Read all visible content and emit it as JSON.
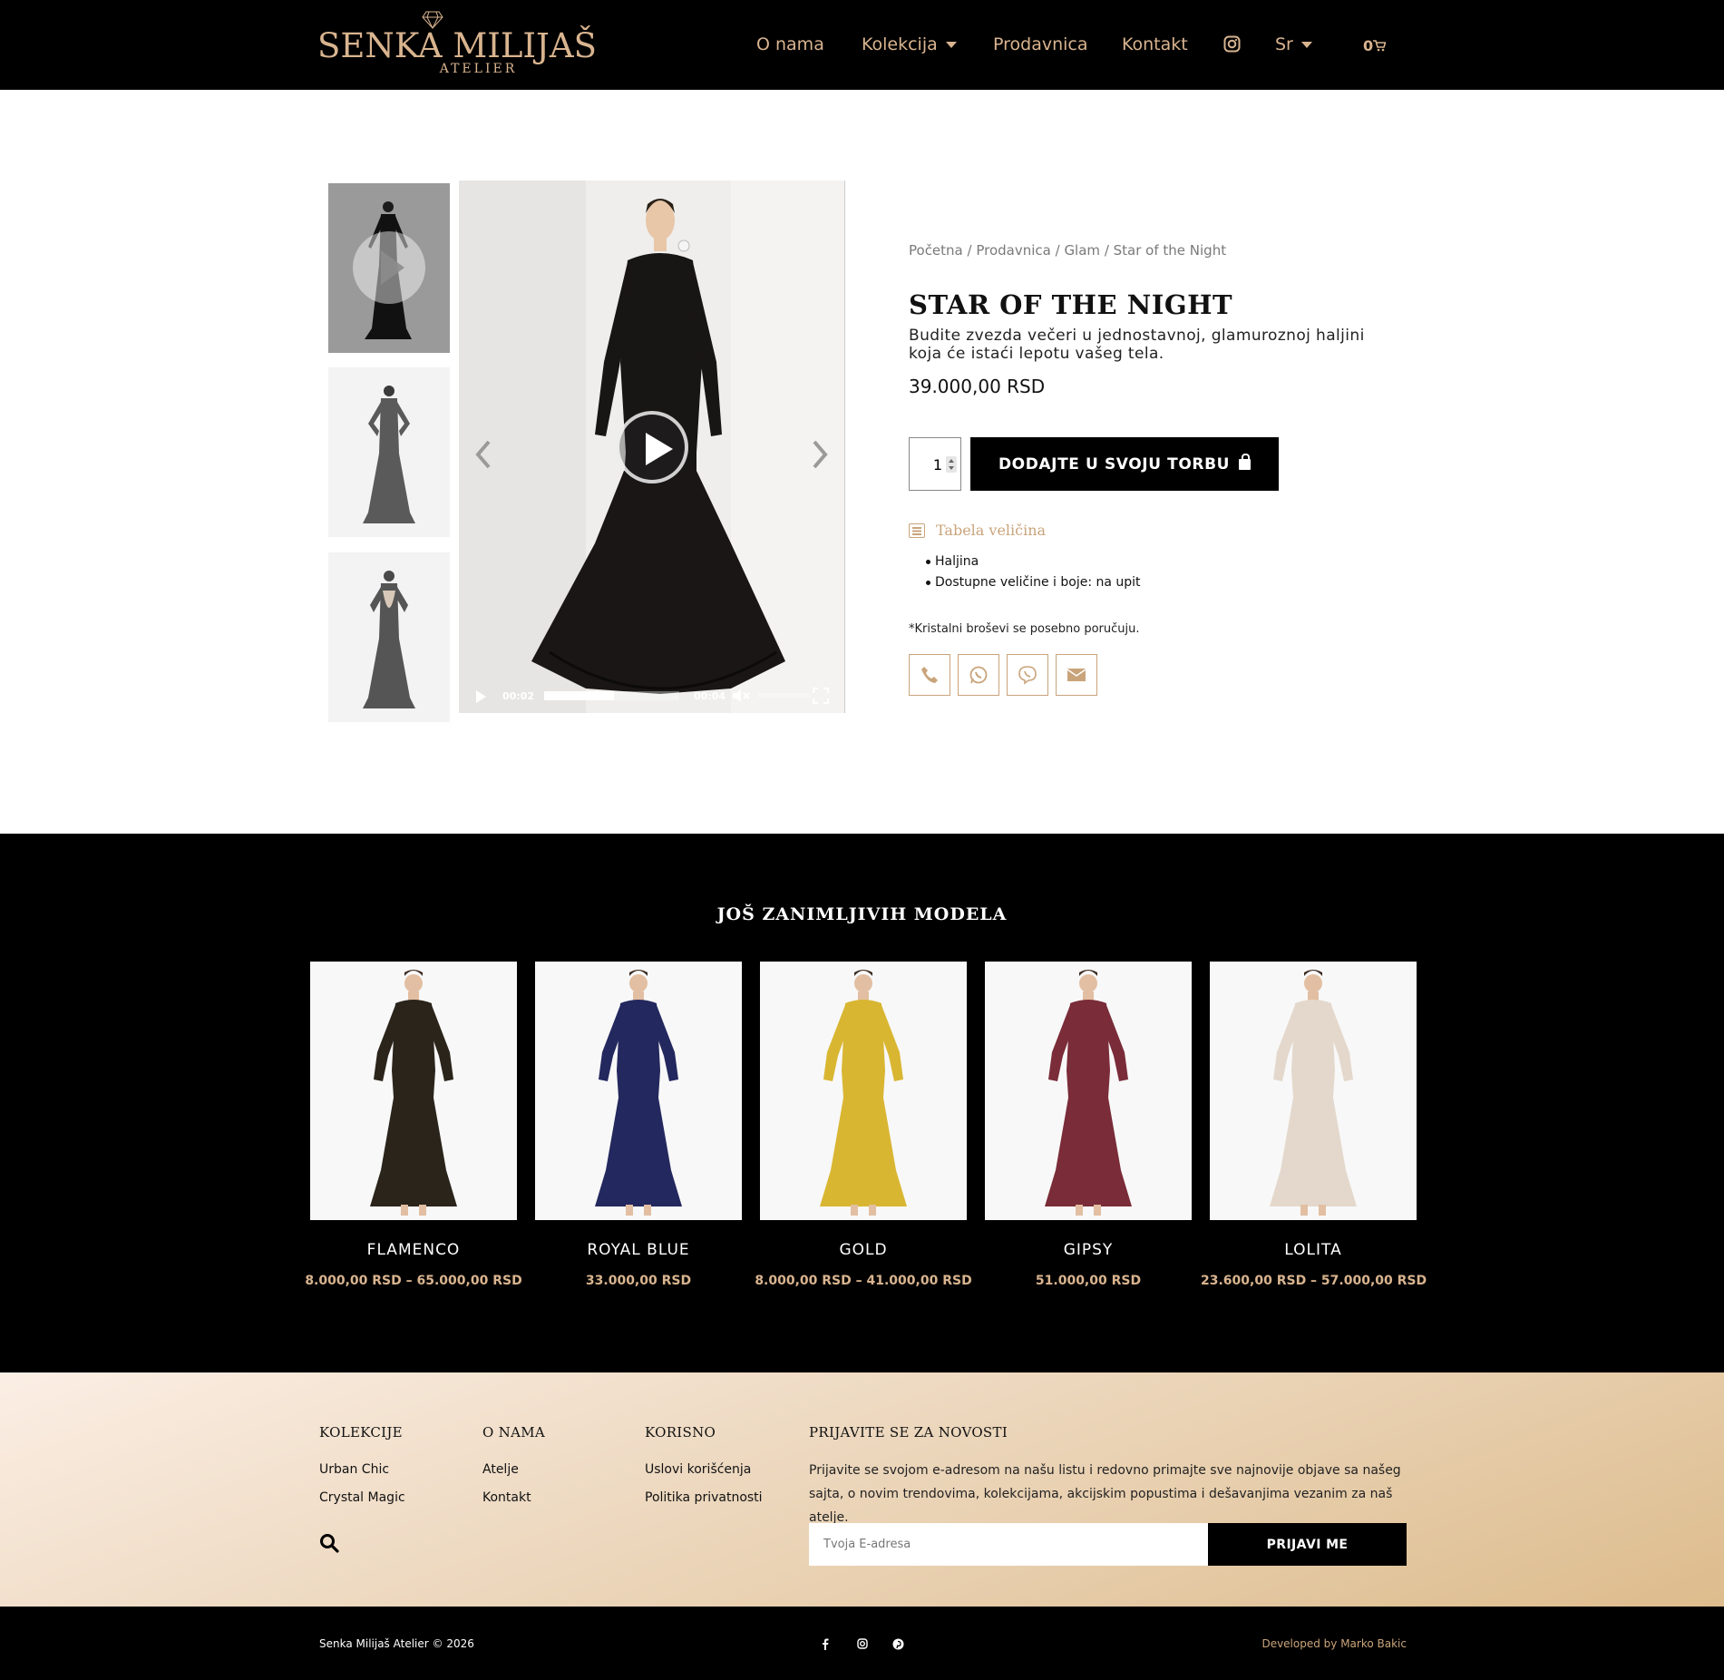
{
  "brand": {
    "name": "SENKA MILIJAŠ",
    "sub": "ATELIER"
  },
  "nav": {
    "about": "O nama",
    "collection": "Kolekcija",
    "shop": "Prodavnica",
    "contact": "Kontakt",
    "language": "Sr",
    "cart_count": "0"
  },
  "breadcrumbs": [
    {
      "label": "Početna"
    },
    {
      "label": "Prodavnica"
    },
    {
      "label": "Glam"
    },
    {
      "label": "Star of the Night"
    }
  ],
  "breadcrumb_sep": " / ",
  "product": {
    "title": "STAR OF THE NIGHT",
    "description": "Budite zvezda večeri u jednostavnoj, glamuroznoj haljini koja će istaći lepotu vašeg tela.",
    "price": "39.000,00 RSD",
    "quantity": "1",
    "add_to_cart": "DODAJTE U SVOJU TORBU",
    "size_table": "Tabela veličina",
    "features": [
      "Haljina",
      "Dostupne veličine i boje: na upit"
    ],
    "note": "*Kristalni broševi se posebno poručuju."
  },
  "video": {
    "current_time": "00:02",
    "duration": "00:04",
    "progress": 0.52
  },
  "share_icons": [
    "phone-icon",
    "whatsapp-icon",
    "viber-icon",
    "envelope-icon"
  ],
  "colors": {
    "gold": "#d9b48f",
    "accent_line": "#c9a47b",
    "black": "#000000"
  },
  "related": {
    "title": "JOŠ ZANIMLJIVIH MODELA",
    "items": [
      {
        "name": "FLAMENCO",
        "price": "8.000,00 RSD – 65.000,00 RSD",
        "color": "#2a241b"
      },
      {
        "name": "ROYAL BLUE",
        "price": "33.000,00 RSD",
        "color": "#23285e"
      },
      {
        "name": "GOLD",
        "price": "8.000,00 RSD – 41.000,00 RSD",
        "color": "#d9b632"
      },
      {
        "name": "GIPSY",
        "price": "51.000,00 RSD",
        "color": "#7a2c38"
      },
      {
        "name": "LOLITA",
        "price": "23.600,00 RSD – 57.000,00 RSD",
        "color": "#e4d8cc"
      }
    ]
  },
  "footer": {
    "col1": {
      "title": "KOLEKCIJE",
      "links": [
        "Urban Chic",
        "Crystal Magic"
      ]
    },
    "col2": {
      "title": "O NAMA",
      "links": [
        "Atelje",
        "Kontakt"
      ]
    },
    "col3": {
      "title": "KORISNO",
      "links": [
        "Uslovi korišćenja",
        "Politika privatnosti"
      ]
    },
    "newsletter": {
      "title": "PRIJAVITE SE ZA NOVOSTI",
      "text": "Prijavite se svojom e-adresom na našu listu i redovno primajte sve najnovije objave sa našeg sajta, o novim trendovima, kolekcijama, akcijskim popustima i dešavanjima vezanim za naš atelje.",
      "placeholder": "Tvoja E-adresa",
      "button": "PRIJAVI ME"
    },
    "copyright": "Senka Milijaš Atelier © 2026",
    "developer": "Developed by Marko Bakic",
    "social": [
      "facebook-icon",
      "instagram-icon",
      "pinterest-icon"
    ]
  }
}
